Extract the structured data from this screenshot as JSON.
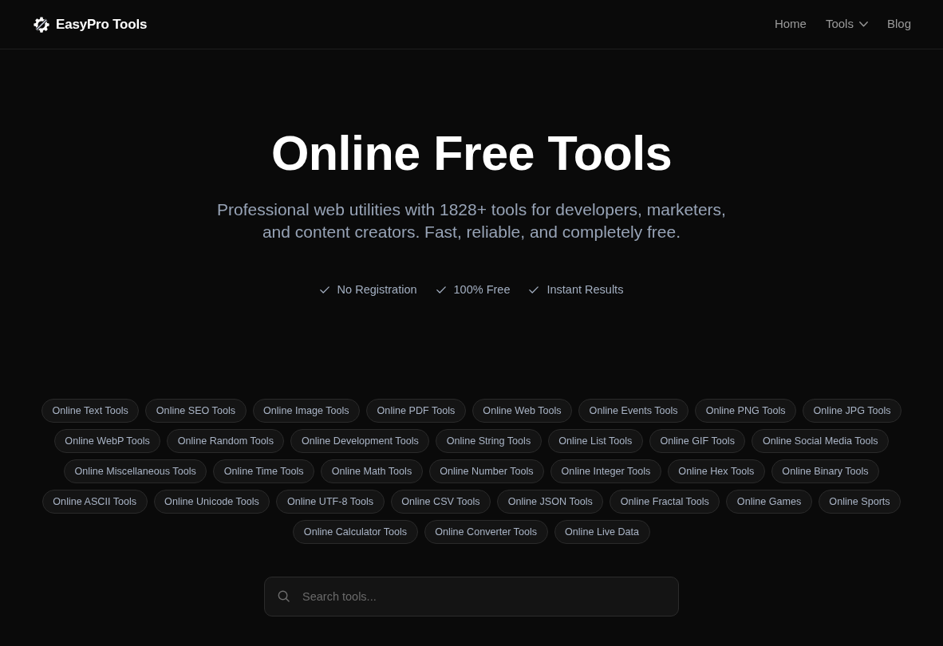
{
  "header": {
    "brand": "EasyPro Tools",
    "nav": [
      {
        "label": "Home",
        "kind": "link"
      },
      {
        "label": "Tools",
        "kind": "dropdown"
      },
      {
        "label": "Blog",
        "kind": "link"
      }
    ]
  },
  "hero": {
    "title": "Online Free Tools",
    "subtitle": "Professional web utilities with 1828+ tools for developers, marketers, and content creators. Fast, reliable, and completely free.",
    "features": [
      "No Registration",
      "100% Free",
      "Instant Results"
    ]
  },
  "categories": [
    "Online Text Tools",
    "Online SEO Tools",
    "Online Image Tools",
    "Online PDF Tools",
    "Online Web Tools",
    "Online Events Tools",
    "Online PNG Tools",
    "Online JPG Tools",
    "Online WebP Tools",
    "Online Random Tools",
    "Online Development Tools",
    "Online String Tools",
    "Online List Tools",
    "Online GIF Tools",
    "Online Social Media Tools",
    "Online Miscellaneous Tools",
    "Online Time Tools",
    "Online Math Tools",
    "Online Number Tools",
    "Online Integer Tools",
    "Online Hex Tools",
    "Online Binary Tools",
    "Online ASCII Tools",
    "Online Unicode Tools",
    "Online UTF-8 Tools",
    "Online CSV Tools",
    "Online JSON Tools",
    "Online Fractal Tools",
    "Online Games",
    "Online Sports",
    "Online Calculator Tools",
    "Online Converter Tools",
    "Online Live Data"
  ],
  "search": {
    "placeholder": "Search tools..."
  }
}
